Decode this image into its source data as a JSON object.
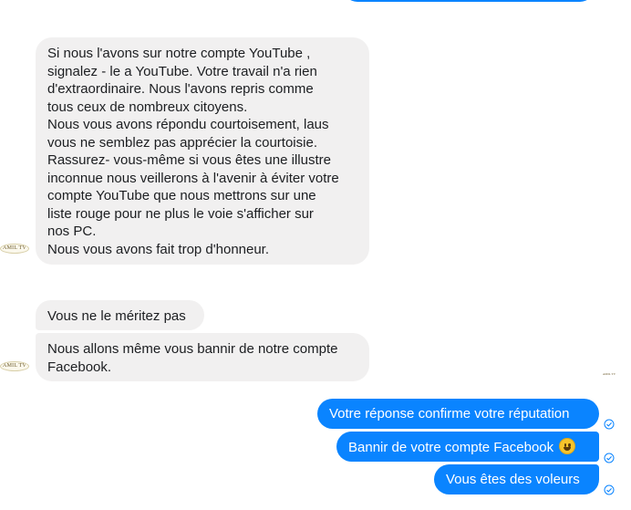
{
  "contact": {
    "avatar_label": "AMIL TV",
    "seen_avatar_label": "AMIL TV"
  },
  "incoming": [
    {
      "lines": [
        "Si nous l'avons sur notre compte YouTube ,",
        "signalez - le a YouTube.  Votre travail n'a rien",
        "d'extraordinaire.  Nous l'avons repris comme",
        "tous ceux de nombreux citoyens.",
        "Nous vous avons répondu courtoisement,  laus",
        "vous ne semblez pas apprécier la courtoisie.",
        "Rassurez- vous-même si vous êtes une illustre",
        "inconnue nous veillerons à l'avenir à éviter votre",
        "compte YouTube que nous mettrons sur une",
        "liste rouge pour ne plus le voie s'afficher sur",
        "nos PC.",
        "Nous vous avons fait trop d'honneur."
      ]
    },
    {
      "lines": [
        "Vous ne le méritez pas"
      ]
    },
    {
      "lines": [
        "Nous allons même vous bannir de notre compte",
        "Facebook."
      ]
    }
  ],
  "outgoing": [
    {
      "text": "Votre réponse confirme votre réputation",
      "emoji": ""
    },
    {
      "text": "Bannir de votre compte Facebook",
      "emoji": "grinning-face"
    },
    {
      "text": "Vous êtes des voleurs",
      "emoji": ""
    }
  ],
  "colors": {
    "incoming_bubble": "#f1f0f0",
    "outgoing_bubble": "#0a84ff",
    "sent_check": "#0a84ff"
  },
  "icons": {
    "status": "sent-check-icon",
    "emoji": "grinning-face-emoji"
  }
}
